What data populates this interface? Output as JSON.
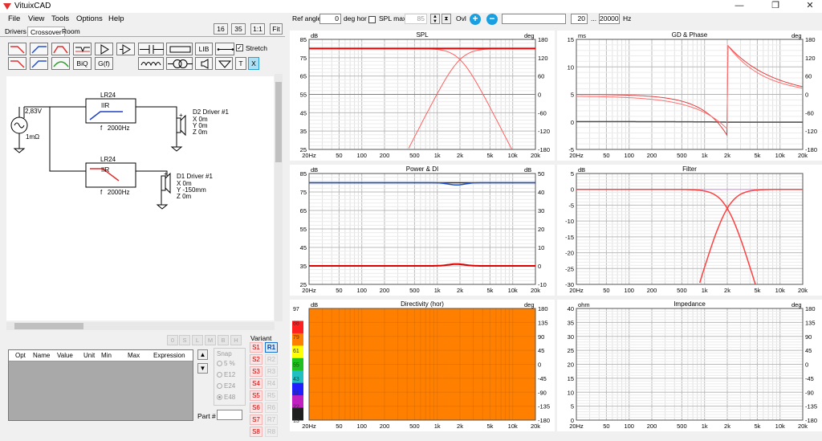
{
  "app": {
    "title": "VituixCAD",
    "colors": {
      "accent": "#e03030",
      "btnblue": "#1a9fe0"
    }
  },
  "window": {
    "min": "—",
    "max": "❐",
    "close": "✕"
  },
  "menu": [
    "File",
    "View",
    "Tools",
    "Options",
    "Help"
  ],
  "tabs": [
    "Drivers",
    "Crossover",
    "Room"
  ],
  "sizebtns": [
    "16",
    "35",
    "1:1",
    "Fit"
  ],
  "toolbar": {
    "biq": "BiQ",
    "gf": "G(f)",
    "lib": "LIB",
    "t": "T",
    "x": "X",
    "stretch": "Stretch"
  },
  "schematic": {
    "source": {
      "voltage": "2,83V",
      "impedance": "1mΩ"
    },
    "blocks": [
      {
        "name": "LR24",
        "type": "IIR",
        "freq": "f   2000Hz"
      },
      {
        "name": "LR24",
        "type": "IIR",
        "freq": "f   2000Hz"
      }
    ],
    "drivers": [
      {
        "name": "D2 Driver #1",
        "x": "X 0m",
        "y": "Y 0m",
        "z": "Z 0m",
        "plus": "+"
      },
      {
        "name": "D1 Driver #1",
        "x": "X 0m",
        "y": "Y -150mm",
        "z": "Z 0m",
        "plus": "+"
      }
    ]
  },
  "partbtns": [
    "0",
    "S",
    "L",
    "M",
    "B",
    "H"
  ],
  "table": {
    "headers": [
      "Opt",
      "Name",
      "Value",
      "Unit",
      "Min",
      "Max",
      "Expression"
    ]
  },
  "snap": {
    "title": "Snap",
    "options": [
      "5 %",
      "E12",
      "E24",
      "E48"
    ]
  },
  "part": {
    "label": "Part #"
  },
  "variant": {
    "label": "Variant",
    "s": [
      "S1",
      "S2",
      "S3",
      "S4",
      "S5",
      "S6",
      "S7",
      "S8"
    ],
    "r": [
      "R1",
      "R2",
      "R3",
      "R4",
      "R5",
      "R6",
      "R7",
      "R8"
    ]
  },
  "top": {
    "ref_angle_label": "Ref angle",
    "ref_angle": "0",
    "deg_hor": "deg hor",
    "spl_max": "SPL max",
    "spl_max_val": "85",
    "ovl": "Ovl",
    "freq_from": "20",
    "ellipsis": "...",
    "freq_to": "20000",
    "hz": "Hz"
  },
  "xticks": [
    "20Hz",
    "50",
    "100",
    "200",
    "500",
    "1k",
    "2k",
    "5k",
    "10k",
    "20k"
  ],
  "charts": {
    "spl": {
      "title": "SPL",
      "lunit": "dB",
      "runit": "deg",
      "left": [
        "85",
        "75",
        "65",
        "55",
        "45",
        "35",
        "25"
      ],
      "right": [
        "180",
        "120",
        "60",
        "0",
        "-60",
        "-120",
        "-180"
      ]
    },
    "gd": {
      "title": "GD & Phase",
      "lunit": "ms",
      "runit": "deg",
      "left": [
        "15",
        "10",
        "5",
        "0",
        "-5"
      ],
      "right": [
        "180",
        "120",
        "60",
        "0",
        "-60",
        "-120",
        "-180"
      ]
    },
    "power": {
      "title": "Power & DI",
      "lunit": "dB",
      "runit": "dB",
      "left": [
        "85",
        "75",
        "65",
        "55",
        "45",
        "35",
        "25"
      ],
      "right": [
        "50",
        "40",
        "30",
        "20",
        "10",
        "0",
        "-10"
      ]
    },
    "filter": {
      "title": "Filter",
      "lunit": "dB",
      "left": [
        "5",
        "0",
        "-5",
        "-10",
        "-15",
        "-20",
        "-25",
        "-30"
      ]
    },
    "dir": {
      "title": "Directivity (hor)",
      "lunit": "dB",
      "runit": "deg",
      "right": [
        "180",
        "135",
        "90",
        "45",
        "0",
        "-45",
        "-90",
        "-135",
        "-180"
      ],
      "scale": [
        "97",
        "88",
        "79",
        "61",
        "55",
        "43",
        "31",
        "22",
        "13"
      ]
    },
    "imp": {
      "title": "Impedance",
      "lunit": "ohm",
      "runit": "deg",
      "left": [
        "40",
        "35",
        "30",
        "25",
        "20",
        "15",
        "10",
        "5",
        "0"
      ],
      "right": [
        "180",
        "135",
        "90",
        "45",
        "0",
        "-45",
        "-90",
        "-135",
        "-180"
      ]
    }
  }
}
